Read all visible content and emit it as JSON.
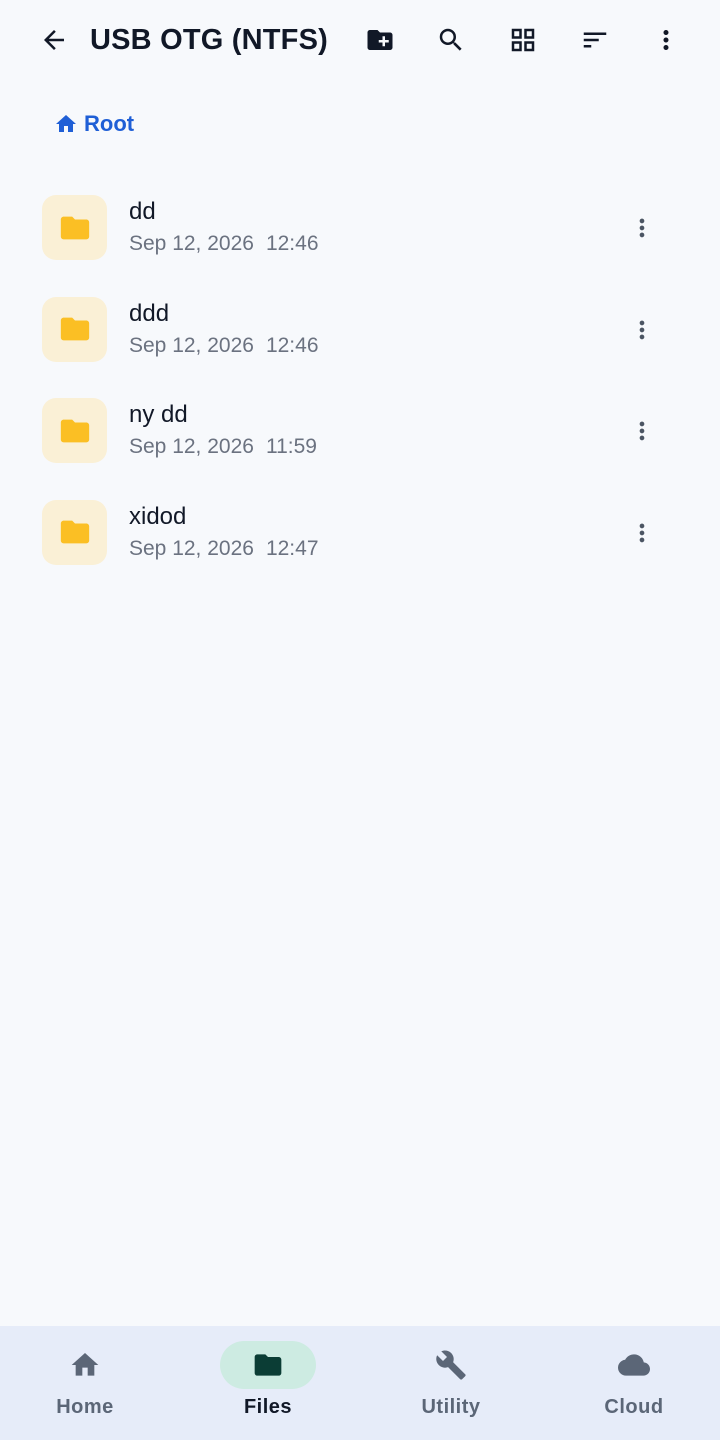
{
  "header": {
    "title": "USB OTG (NTFS)",
    "back_icon": "arrow-back-icon",
    "actions": [
      "create-folder-icon",
      "search-icon",
      "grid-view-icon",
      "sort-icon",
      "more-vert-icon"
    ]
  },
  "breadcrumb": {
    "icon": "home-icon",
    "label": "Root"
  },
  "files": [
    {
      "name": "dd",
      "date": "Sep 12, 2026",
      "time": "12:46"
    },
    {
      "name": "ddd",
      "date": "Sep 12, 2026",
      "time": "12:46"
    },
    {
      "name": "ny dd",
      "date": "Sep 12, 2026",
      "time": "11:59"
    },
    {
      "name": "xidod",
      "date": "Sep 12, 2026",
      "time": "12:47"
    }
  ],
  "bottom_nav": {
    "items": [
      {
        "label": "Home",
        "icon": "home-icon",
        "active": false
      },
      {
        "label": "Files",
        "icon": "folder-icon",
        "active": true
      },
      {
        "label": "Utility",
        "icon": "wrench-icon",
        "active": false
      },
      {
        "label": "Cloud",
        "icon": "cloud-icon",
        "active": false
      }
    ]
  },
  "colors": {
    "background": "#f7f9fc",
    "accent": "#1f5fd6",
    "folder": "#fbbf24",
    "folder_tile": "#faf0d6",
    "nav_background": "#e6ecf9",
    "nav_active_pill": "#cdebe2"
  }
}
